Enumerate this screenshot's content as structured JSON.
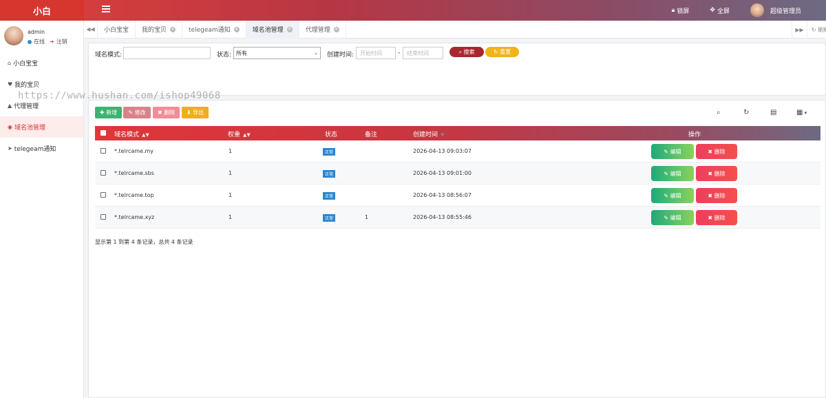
{
  "header": {
    "logo": "小白",
    "lock_label": "锁屏",
    "fullscreen_label": "全屏",
    "admin_name": "超级管理员"
  },
  "sidebar": {
    "username": "admin",
    "status_online": "在线",
    "logout": "注销",
    "items": [
      {
        "label": "小白宝宝",
        "icon": "home-icon"
      },
      {
        "label": "我的宝贝",
        "icon": "heart-icon"
      },
      {
        "label": "代理管理",
        "icon": "user-icon"
      },
      {
        "label": "域名池管理",
        "icon": "globe-icon"
      },
      {
        "label": "telegeam通知",
        "icon": "arrow-circle-icon"
      }
    ]
  },
  "tabs": [
    {
      "label": "小白宝宝",
      "closable": false
    },
    {
      "label": "我的宝贝",
      "closable": true
    },
    {
      "label": "telegeam通知",
      "closable": true
    },
    {
      "label": "域名池管理",
      "closable": true,
      "active": true
    },
    {
      "label": "代理管理",
      "closable": true
    }
  ],
  "tabbar_refresh": "刷新",
  "search": {
    "domain_label": "域名模式:",
    "domain_value": "",
    "status_label": "状态:",
    "status_value": "所有",
    "created_label": "创建时间:",
    "start_placeholder": "开始时间",
    "range_sep": "-",
    "end_placeholder": "结束时间",
    "search_button": "搜索",
    "reset_button": "重置"
  },
  "toolbar": {
    "add": "新增",
    "edit": "修改",
    "delete": "删除",
    "export": "导出"
  },
  "table": {
    "columns": [
      "域名模式",
      "权重",
      "状态",
      "备注",
      "创建时间",
      "操作"
    ],
    "rows": [
      {
        "domain": "*.telrcame.my",
        "weight": "1",
        "status": "正常",
        "remark": "",
        "created": "2026-04-13 09:03:07"
      },
      {
        "domain": "*.telrcame.sbs",
        "weight": "1",
        "status": "正常",
        "remark": "",
        "created": "2026-04-13 09:01:00"
      },
      {
        "domain": "*.telrcame.top",
        "weight": "1",
        "status": "正常",
        "remark": "",
        "created": "2026-04-13 08:56:07"
      },
      {
        "domain": "*.telrcame.xyz",
        "weight": "1",
        "status": "正常",
        "remark": "1",
        "created": "2026-04-13 08:55:46"
      }
    ],
    "edit_label": "编辑",
    "delete_label": "删除",
    "summary": "显示第 1 到第 4 条记录，总共 4 条记录"
  },
  "watermark": "https://www.hushan.com/ishop49068",
  "colors": {
    "brand_red": "#d7362f",
    "badge_blue": "#2a86d3",
    "edit_green": "#5dc46a",
    "delete_red": "#f4504c",
    "add_green": "#3cb371",
    "export_orange": "#f0ad1f"
  }
}
